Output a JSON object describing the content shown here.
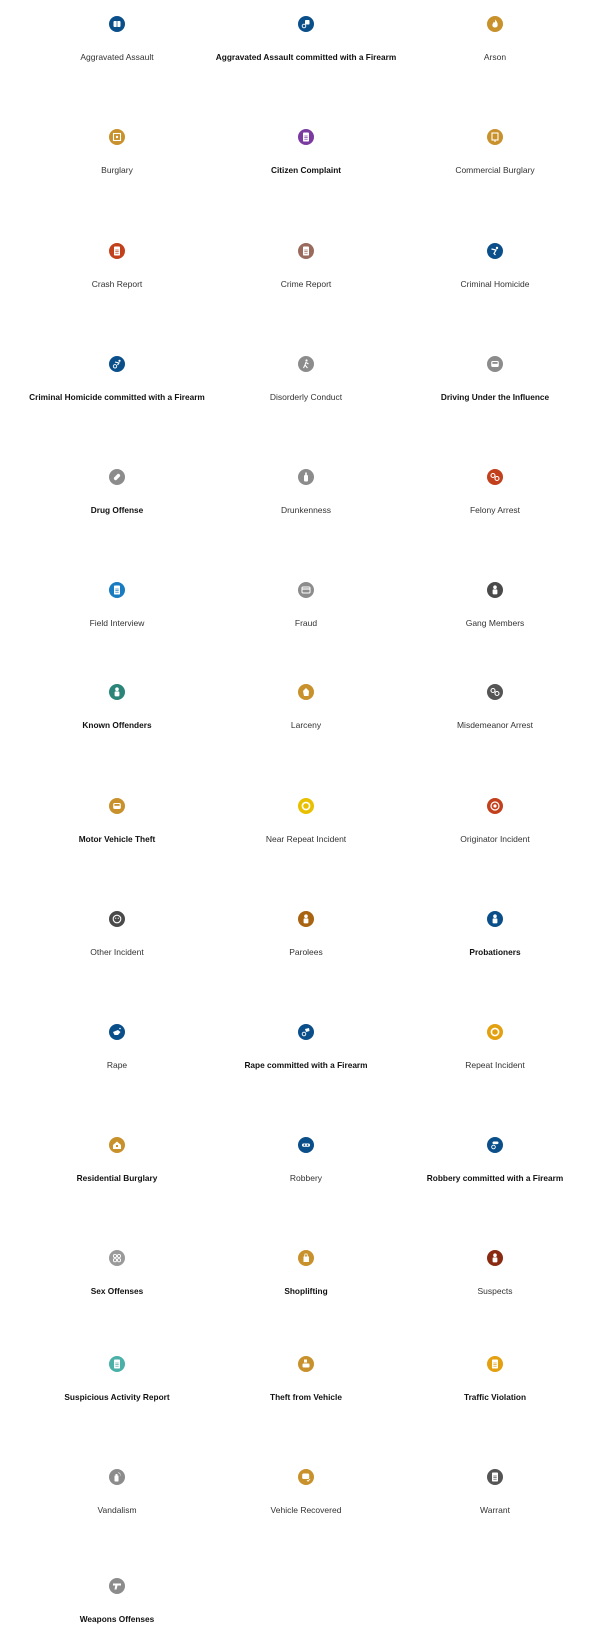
{
  "items": [
    {
      "label": "Aggravated Assault",
      "icon": "fist-icon",
      "color": "#0b4f8a",
      "bold": false
    },
    {
      "label": "Aggravated Assault committed with a Firearm",
      "icon": "fist-gun-icon",
      "color": "#0b4f8a",
      "bold": true
    },
    {
      "label": "Arson",
      "icon": "flame-icon",
      "color": "#c8912c",
      "bold": false
    },
    {
      "label": "Burglary",
      "icon": "safe-icon",
      "color": "#c8912c",
      "bold": false
    },
    {
      "label": "Citizen Complaint",
      "icon": "document-icon",
      "color": "#7b3aa0",
      "bold": true
    },
    {
      "label": "Commercial Burglary",
      "icon": "storefront-icon",
      "color": "#c8912c",
      "bold": false
    },
    {
      "label": "Crash Report",
      "icon": "document-icon",
      "color": "#c2401c",
      "bold": false
    },
    {
      "label": "Crime Report",
      "icon": "document-icon",
      "color": "#9a6a5c",
      "bold": false
    },
    {
      "label": "Criminal Homicide",
      "icon": "falling-person-icon",
      "color": "#0b4f8a",
      "bold": false
    },
    {
      "label": "Criminal Homicide committed with a Firearm",
      "icon": "falling-person-gun-icon",
      "color": "#0b4f8a",
      "bold": true
    },
    {
      "label": "Disorderly Conduct",
      "icon": "person-walking-icon",
      "color": "#8c8c8c",
      "bold": false
    },
    {
      "label": "Driving Under the Influence",
      "icon": "car-front-icon",
      "color": "#8c8c8c",
      "bold": true
    },
    {
      "label": "Drug Offense",
      "icon": "pill-icon",
      "color": "#8c8c8c",
      "bold": true
    },
    {
      "label": "Drunkenness",
      "icon": "bottle-icon",
      "color": "#8c8c8c",
      "bold": false
    },
    {
      "label": "Felony Arrest",
      "icon": "handcuffs-icon",
      "color": "#c2401c",
      "bold": false
    },
    {
      "label": "Field Interview",
      "icon": "document-icon",
      "color": "#1a7cc0",
      "bold": false
    },
    {
      "label": "Fraud",
      "icon": "credit-card-icon",
      "color": "#8c8c8c",
      "bold": false
    },
    {
      "label": "Gang Members",
      "icon": "person-icon",
      "color": "#4a4a4a",
      "bold": false
    },
    {
      "label": "Known Offenders",
      "icon": "person-icon",
      "color": "#2a8478",
      "bold": true
    },
    {
      "label": "Larceny",
      "icon": "hand-grab-icon",
      "color": "#c8912c",
      "bold": false
    },
    {
      "label": "Misdemeanor Arrest",
      "icon": "handcuffs-icon",
      "color": "#555555",
      "bold": false
    },
    {
      "label": "Motor Vehicle Theft",
      "icon": "car-front-icon",
      "color": "#c8912c",
      "bold": true
    },
    {
      "label": "Near Repeat Incident",
      "icon": "ring-icon",
      "color": "#e8c000",
      "bold": false
    },
    {
      "label": "Originator Incident",
      "icon": "target-icon",
      "color": "#c2401c",
      "bold": false
    },
    {
      "label": "Other Incident",
      "icon": "face-icon",
      "color": "#4a4a4a",
      "bold": false
    },
    {
      "label": "Parolees",
      "icon": "person-icon",
      "color": "#a86410",
      "bold": false
    },
    {
      "label": "Probationers",
      "icon": "person-icon",
      "color": "#0b4f8a",
      "bold": true
    },
    {
      "label": "Rape",
      "icon": "whistle-icon",
      "color": "#0b4f8a",
      "bold": false
    },
    {
      "label": "Rape committed with a Firearm",
      "icon": "whistle-gun-icon",
      "color": "#0b4f8a",
      "bold": true
    },
    {
      "label": "Repeat Incident",
      "icon": "ring-icon",
      "color": "#e3a010",
      "bold": false
    },
    {
      "label": "Residential Burglary",
      "icon": "house-icon",
      "color": "#c8912c",
      "bold": true
    },
    {
      "label": "Robbery",
      "icon": "mask-icon",
      "color": "#0b4f8a",
      "bold": false
    },
    {
      "label": "Robbery committed with a Firearm",
      "icon": "mask-gun-icon",
      "color": "#0b4f8a",
      "bold": true
    },
    {
      "label": "Sex Offenses",
      "icon": "gender-icon",
      "color": "#9a9a9a",
      "bold": true
    },
    {
      "label": "Shoplifting",
      "icon": "shopping-bag-icon",
      "color": "#c8912c",
      "bold": true
    },
    {
      "label": "Suspects",
      "icon": "person-icon",
      "color": "#8a2a10",
      "bold": false
    },
    {
      "label": "Suspicious Activity Report",
      "icon": "document-icon",
      "color": "#4ab0a8",
      "bold": true
    },
    {
      "label": "Theft from Vehicle",
      "icon": "car-hand-icon",
      "color": "#c8912c",
      "bold": true
    },
    {
      "label": "Traffic Violation",
      "icon": "document-icon",
      "color": "#e3a010",
      "bold": true
    },
    {
      "label": "Vandalism",
      "icon": "spray-can-icon",
      "color": "#8c8c8c",
      "bold": false
    },
    {
      "label": "Vehicle Recovered",
      "icon": "car-check-icon",
      "color": "#c8912c",
      "bold": false
    },
    {
      "label": "Warrant",
      "icon": "document-icon",
      "color": "#555555",
      "bold": false
    },
    {
      "label": "Weapons Offenses",
      "icon": "handgun-icon",
      "color": "#8c8c8c",
      "bold": true
    }
  ]
}
